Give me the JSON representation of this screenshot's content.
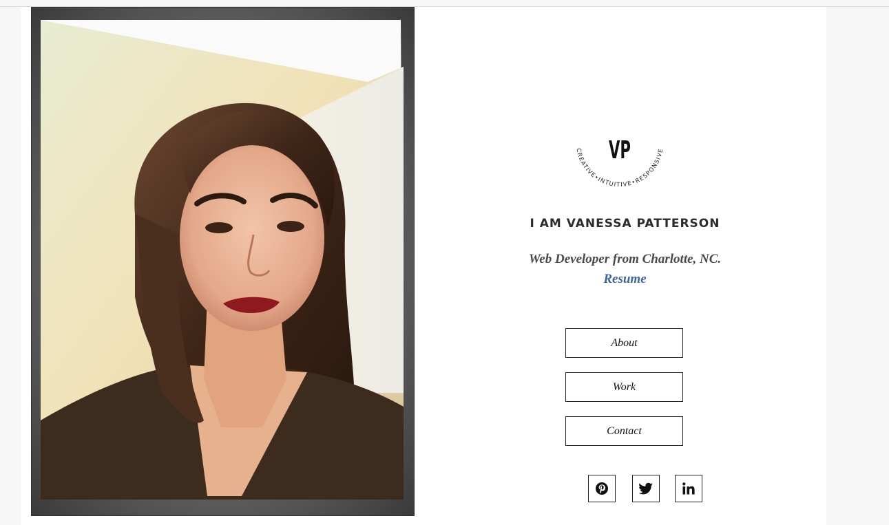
{
  "profile": {
    "heading": "I AM VANESSA PATTERSON",
    "tagline": "Web Developer from Charlotte, NC.",
    "resume_label": "Resume"
  },
  "logo": {
    "monogram": "VP",
    "arc_text": "CREATIVE•INTUITIVE•RESPONSIVE"
  },
  "nav": {
    "about": "About",
    "work": "Work",
    "contact": "Contact"
  },
  "social": [
    {
      "network": "Pinterest",
      "icon": "pinterest-icon"
    },
    {
      "network": "Twitter",
      "icon": "twitter-icon"
    },
    {
      "network": "LinkedIn",
      "icon": "linkedin-icon"
    }
  ],
  "colors": {
    "link": "#3a64a2",
    "text": "#2b2b2b",
    "border": "#222222"
  }
}
